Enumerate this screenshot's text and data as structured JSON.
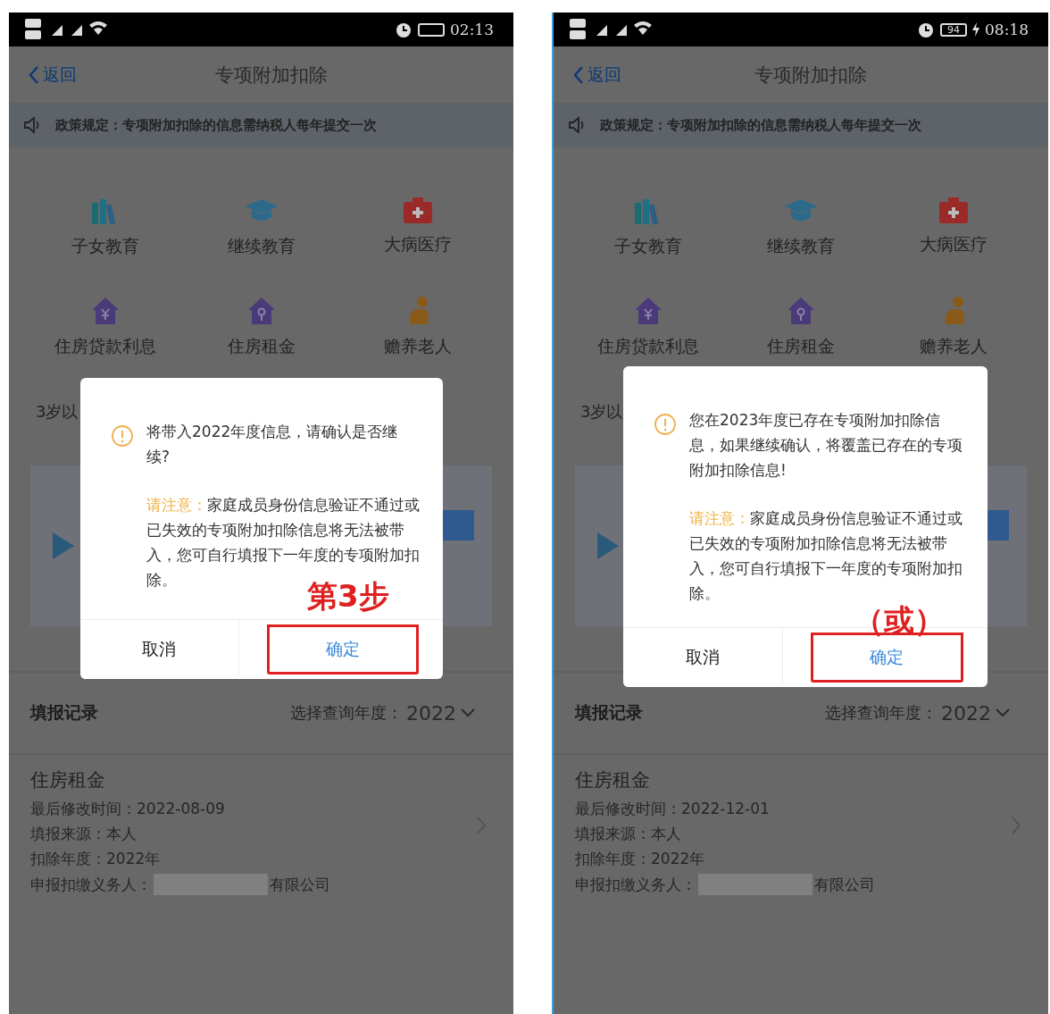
{
  "phones": [
    {
      "status": {
        "time": "02:13",
        "charging": false
      },
      "nav": {
        "back": "返回",
        "title": "专项附加扣除"
      },
      "notice": {
        "text": "政策规定：专项附加扣除的信息需纳税人每年提交一次"
      },
      "categories": [
        {
          "label": "子女教育",
          "kind": "books"
        },
        {
          "label": "继续教育",
          "kind": "cap"
        },
        {
          "label": "大病医疗",
          "kind": "medkit"
        },
        {
          "label": "住房贷款利息",
          "kind": "house-yen"
        },
        {
          "label": "住房租金",
          "kind": "house-key"
        },
        {
          "label": "赡养老人",
          "kind": "elder"
        }
      ],
      "partial_text": "3岁以",
      "records": {
        "title": "填报记录",
        "year_prompt": "选择查询年度：",
        "year": "2022"
      },
      "record": {
        "title": "住房租金",
        "lines": [
          {
            "text": "最后修改时间：2022-08-09"
          },
          {
            "text": "填报来源：本人"
          },
          {
            "text": "扣除年度：2022年"
          },
          {
            "text": "申报扣缴义务人：",
            "redacted": true,
            "suffix": "有限公司"
          }
        ]
      },
      "dialog": {
        "message": "将带入2022年度信息，请确认是否继续?",
        "note_label": "请注意：",
        "note_text": "家庭成员身份信息验证不通过或已失效的专项附加扣除信息将无法被带入，您可自行填报下一年度的专项附加扣除。",
        "cancel": "取消",
        "confirm": "确定",
        "confirm_highlighted": true,
        "annotation": "第3步"
      }
    },
    {
      "status": {
        "time": "08:18",
        "battery_label": "94",
        "charging": true
      },
      "nav": {
        "back": "返回",
        "title": "专项附加扣除"
      },
      "notice": {
        "text": "政策规定：专项附加扣除的信息需纳税人每年提交一次"
      },
      "categories": [
        {
          "label": "子女教育",
          "kind": "books"
        },
        {
          "label": "继续教育",
          "kind": "cap"
        },
        {
          "label": "大病医疗",
          "kind": "medkit"
        },
        {
          "label": "住房贷款利息",
          "kind": "house-yen"
        },
        {
          "label": "住房租金",
          "kind": "house-key"
        },
        {
          "label": "赡养老人",
          "kind": "elder"
        }
      ],
      "partial_text": "3岁以",
      "records": {
        "title": "填报记录",
        "year_prompt": "选择查询年度：",
        "year": "2022"
      },
      "record": {
        "title": "住房租金",
        "lines": [
          {
            "text": "最后修改时间：2022-12-01"
          },
          {
            "text": "填报来源：本人"
          },
          {
            "text": "扣除年度：2022年"
          },
          {
            "text": "申报扣缴义务人：",
            "redacted": true,
            "suffix": "有限公司"
          }
        ]
      },
      "dialog": {
        "message": "您在2023年度已存在专项附加扣除信息，如果继续确认，将覆盖已存在的专项附加扣除信息!",
        "note_label": "请注意：",
        "note_text": "家庭成员身份信息验证不通过或已失效的专项附加扣除信息将无法被带入，您可自行填报下一年度的专项附加扣除。",
        "cancel": "取消",
        "confirm": "确定",
        "confirm_highlighted": true,
        "annotation": "（或）"
      }
    }
  ]
}
